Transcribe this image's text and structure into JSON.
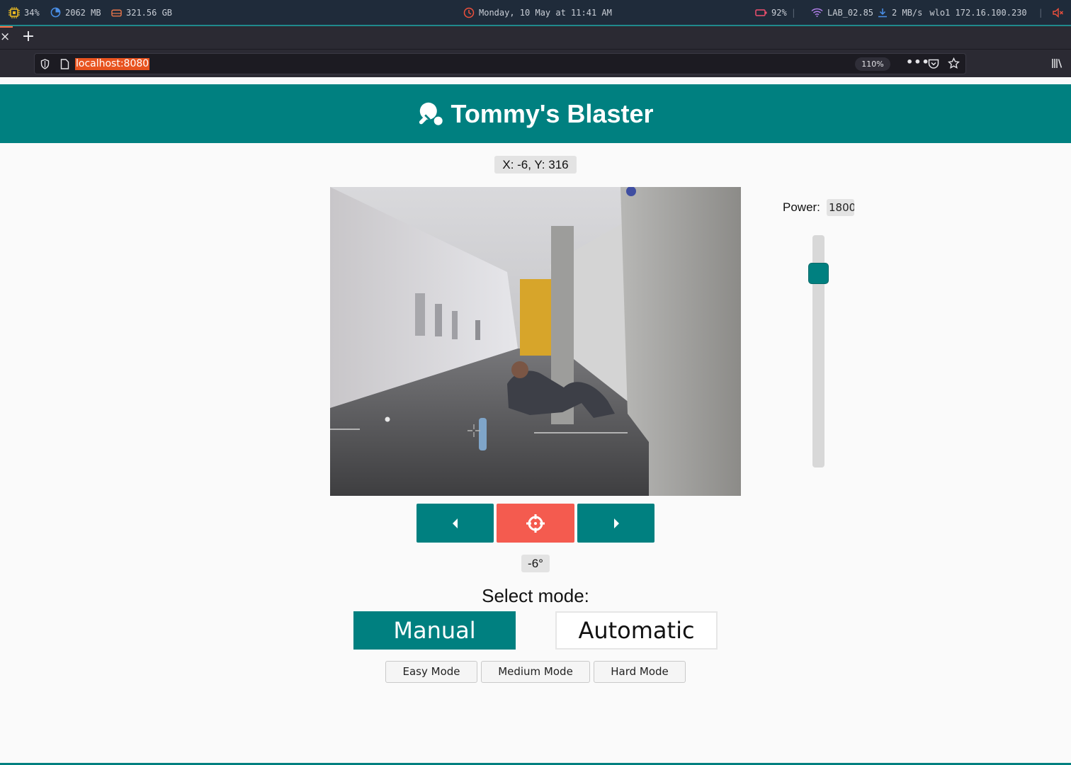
{
  "system_bar": {
    "cpu": "34%",
    "memory": "2062 MB",
    "disk": "321.56 GB",
    "datetime": "Monday, 10 May at 11:41 AM",
    "battery": "92%",
    "wifi": "LAB_02.85",
    "download_speed": "2 MB/s",
    "network": "wlo1 172.16.100.230"
  },
  "browser": {
    "url": "localhost:8080",
    "zoom": "110%",
    "more_label": "•••"
  },
  "app": {
    "title": "Tommy's Blaster",
    "coordinates": "X: -6, Y: 316",
    "power_label": "Power:",
    "power_value": "1800",
    "power_level_fraction": 0.87,
    "angle": "-6°",
    "mode_title": "Select mode:",
    "modes": [
      "Manual",
      "Automatic"
    ],
    "active_mode": "Manual",
    "difficulties": [
      "Easy Mode",
      "Medium Mode",
      "Hard Mode"
    ]
  },
  "colors": {
    "primary": "#008080",
    "fire": "#f45b4f",
    "url_highlight": "#e8531f"
  }
}
